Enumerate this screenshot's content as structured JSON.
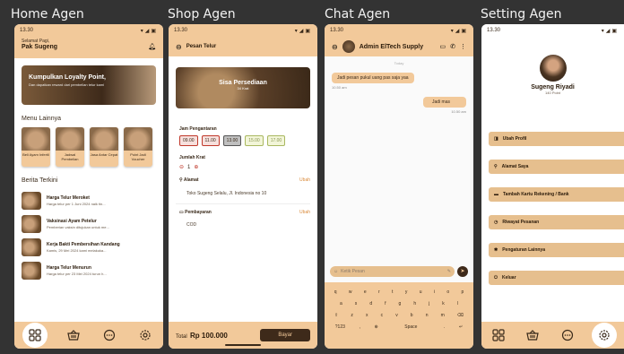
{
  "panels": {
    "home": "Home Agen",
    "shop": "Shop Agen",
    "chat": "Chat Agen",
    "setting": "Setting Agen"
  },
  "status_time": "13.30",
  "home": {
    "greeting": "Selamat Pagi,",
    "user": "Pak Sugeng",
    "banner_title": "Kumpulkan Loyalty Point,",
    "banner_sub": "Dan dapatkan reward dari pembelian telur kami",
    "menu_title": "Menu Lainnya",
    "menu": [
      {
        "label": "Beli Ayam Infertil"
      },
      {
        "label": "Jadwal Pembelian"
      },
      {
        "label": "Jasa Antar Cepat"
      },
      {
        "label": "Point Jadi Voucher"
      }
    ],
    "news_title": "Berita Terkini",
    "news": [
      {
        "title": "Harga Telur Meroket",
        "sub": "Harga telur per 1 Juni 2024 naik tin..."
      },
      {
        "title": "Vaksinasi Ayam Petelur",
        "sub": "Pemberian vaksin ditujukan untuk me..."
      },
      {
        "title": "Kerja Bakti Pembersihan Kandang",
        "sub": "Kamis, 29 Mei 2024 kami melakuka..."
      },
      {
        "title": "Harga Telur Menurun",
        "sub": "Harga telur per 23 Mei 2024 turun h..."
      }
    ]
  },
  "shop": {
    "header": "Pesan Telur",
    "stock_title": "Sisa Persediaan",
    "stock_value": "34 Krat",
    "delivery_label": "Jam Pengantaran",
    "slots": [
      "09.00",
      "11.00",
      "13.00",
      "15.00",
      "17.00"
    ],
    "qty_label": "Jumlah Krat",
    "qty_value": "1",
    "address_label": "Alamat",
    "address_edit": "Ubah",
    "address_value": "Toko Sugeng Selalu, Jl. Indonesia no 10",
    "payment_label": "Pembayaran",
    "payment_edit": "Ubah",
    "payment_value": "COD",
    "total_label": "Total",
    "total_value": "Rp 100.000",
    "pay_button": "Bayar"
  },
  "chat": {
    "contact": "Admin ElTech Supply",
    "day": "Today",
    "msg1": "Jadi pesan pukul uang pas saja yaa",
    "msg1_time": "10.50 am",
    "msg2": "Jadi mas",
    "msg2_time": "10.50 am",
    "input_placeholder": "Ketik Pesan",
    "keys_row1": [
      "q",
      "w",
      "e",
      "r",
      "t",
      "y",
      "u",
      "i",
      "o",
      "p"
    ],
    "keys_row2": [
      "a",
      "s",
      "d",
      "f",
      "g",
      "h",
      "j",
      "k",
      "l"
    ],
    "keys_row3": [
      "z",
      "x",
      "c",
      "v",
      "b",
      "n",
      "m"
    ],
    "key_num": "?123",
    "key_comma": ",",
    "key_space": "Space",
    "key_dot": "."
  },
  "setting": {
    "name": "Sugeng Riyadi",
    "points": "140 Point",
    "items": [
      "Ubah Profil",
      "Alamat Saya",
      "Tambah Kartu Rekening / Bank",
      "Riwayat Pesanan",
      "Pengaturan Lainnya",
      "Keluar"
    ]
  },
  "colors": {
    "background": "#333333",
    "accent": "#f2c99a",
    "dark": "#3a2a1a"
  }
}
